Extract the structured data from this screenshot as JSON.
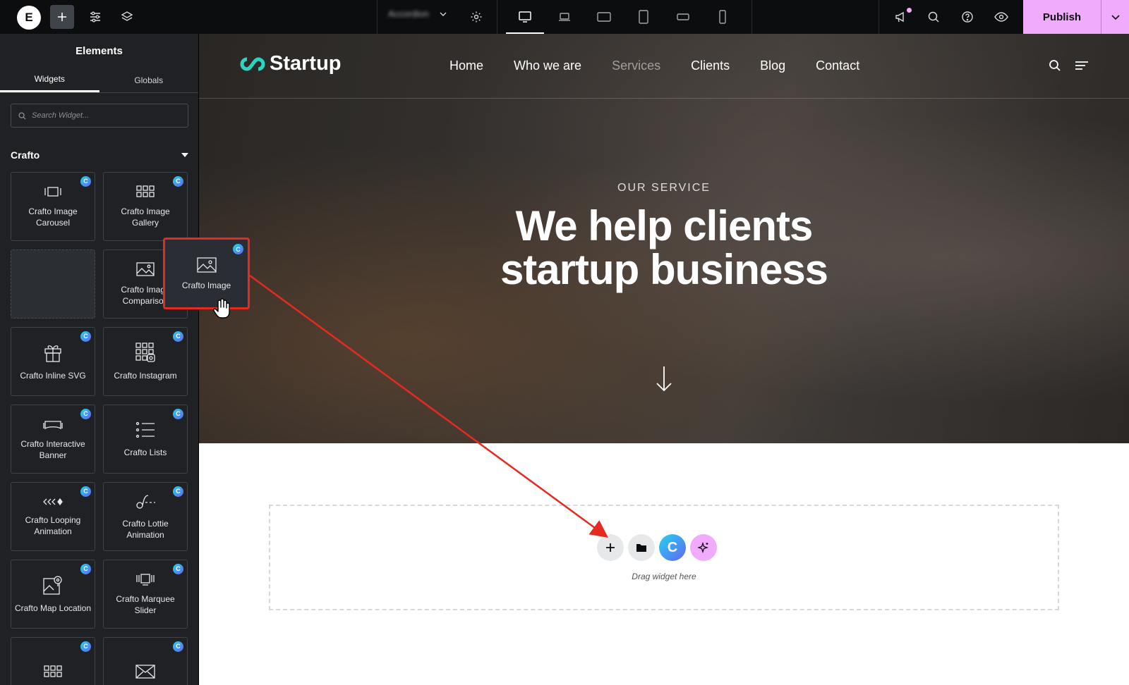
{
  "topbar": {
    "logo_letter": "E",
    "page_name": "Accordion",
    "publish_label": "Publish"
  },
  "sidebar": {
    "title": "Elements",
    "tabs": [
      "Widgets",
      "Globals"
    ],
    "search_placeholder": "Search Widget...",
    "category": "Crafto",
    "badge_letter": "C",
    "widgets": [
      {
        "label": "Crafto Image Carousel",
        "icon": "carousel-icon"
      },
      {
        "label": "Crafto Image Gallery",
        "icon": "gallery-grid-icon"
      },
      {
        "label": "",
        "icon": "placeholder"
      },
      {
        "label": "Crafto Image Comparison",
        "icon": "image-icon"
      },
      {
        "label": "Crafto Inline SVG",
        "icon": "gift-icon"
      },
      {
        "label": "Crafto Instagram",
        "icon": "instagram-grid-icon"
      },
      {
        "label": "Crafto Interactive Banner",
        "icon": "banner-icon"
      },
      {
        "label": "Crafto Lists",
        "icon": "list-icon"
      },
      {
        "label": "Crafto Looping Animation",
        "icon": "looping-arrows-icon"
      },
      {
        "label": "Crafto Lottie Animation",
        "icon": "lottie-icon"
      },
      {
        "label": "Crafto Map Location",
        "icon": "map-pin-icon"
      },
      {
        "label": "Crafto Marquee Slider",
        "icon": "marquee-icon"
      },
      {
        "label": "",
        "icon": "grid-icon"
      },
      {
        "label": "",
        "icon": "envelope-icon"
      }
    ]
  },
  "dragging": {
    "label": "Crafto Image",
    "badge_letter": "C"
  },
  "site": {
    "brand": "Startup",
    "nav": [
      "Home",
      "Who we are",
      "Services",
      "Clients",
      "Blog",
      "Contact"
    ],
    "kicker": "OUR SERVICE",
    "headline_line1": "We help clients",
    "headline_line2": "startup business"
  },
  "dropzone": {
    "text": "Drag widget here",
    "c_letter": "C"
  },
  "colors": {
    "accent_publish": "#f0abfc",
    "drag_highlight": "#e52b20",
    "brand_teal": "#2dd4bf"
  }
}
